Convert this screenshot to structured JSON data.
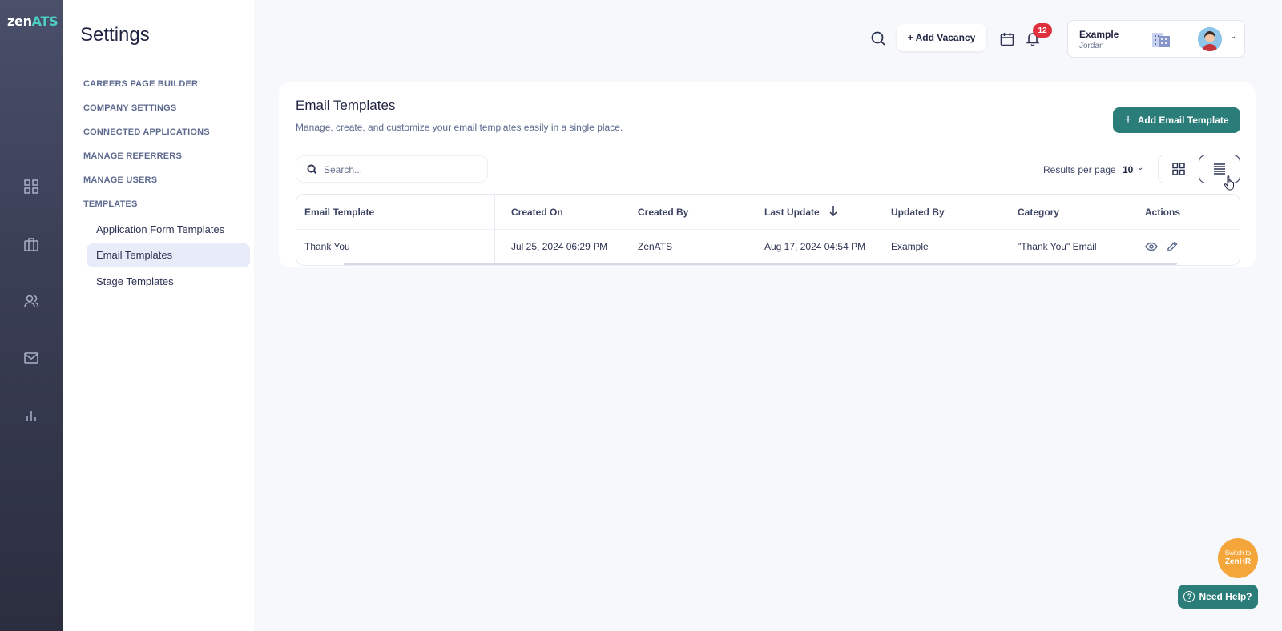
{
  "brand": {
    "zen": "zen",
    "ats": "ATS"
  },
  "settings": {
    "title": "Settings",
    "nav": [
      "CAREERS PAGE BUILDER",
      "COMPANY SETTINGS",
      "CONNECTED APPLICATIONS",
      "MANAGE REFERRERS",
      "MANAGE USERS",
      "TEMPLATES"
    ],
    "templates_sub": [
      "Application Form Templates",
      "Email Templates",
      "Stage Templates"
    ],
    "active_sub": "Email Templates"
  },
  "topbar": {
    "add_vacancy": "+ Add Vacancy",
    "notifications_count": "12",
    "account_name": "Example",
    "account_user": "Jordan"
  },
  "card": {
    "title": "Email Templates",
    "subtitle": "Manage, create, and customize your email templates easily in a single place.",
    "add_button": "Add Email Template",
    "search_placeholder": "Search...",
    "results_per_page_label": "Results per page",
    "results_per_page_value": "10"
  },
  "table": {
    "headers": [
      "Email Template",
      "Created On",
      "Created By",
      "Last Update",
      "Updated By",
      "Category",
      "Actions"
    ],
    "rows": [
      [
        "Thank You",
        "Jul 25, 2024 06:29 PM",
        "ZenATS",
        "Aug 17, 2024 04:54 PM",
        "Example",
        "\"Thank You\" Email"
      ]
    ]
  },
  "floating": {
    "switch_line1": "Switch to",
    "switch_line2": "ZenHR",
    "need_help": "Need Help?"
  },
  "colors": {
    "teal": "#2a7d79",
    "badge_red": "#e0303e",
    "orange": "#f4a63a",
    "rail_dark": "#2b2e3f"
  }
}
